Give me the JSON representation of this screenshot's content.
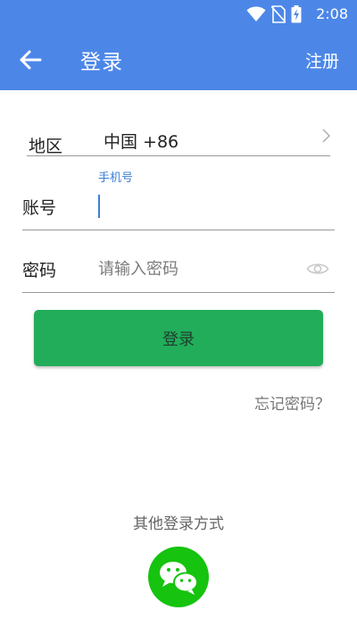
{
  "status_bar": {
    "time": "2:08",
    "icons": [
      "wifi-icon",
      "no-sim-icon",
      "battery-charging-icon"
    ]
  },
  "toolbar": {
    "back_icon": "arrow-left-icon",
    "title": "登录",
    "register_label": "注册"
  },
  "form": {
    "region": {
      "label": "地区",
      "value": "中国 +86",
      "icon": "chevron-right-icon"
    },
    "phone": {
      "label": "账号",
      "float_label": "手机号",
      "value": ""
    },
    "password": {
      "label": "密码",
      "placeholder": "请输入密码",
      "icon": "eye-icon"
    }
  },
  "login_button_label": "登录",
  "forgot_password_label": "忘记密码？",
  "other_login": {
    "label": "其他登录方式",
    "icon": "wechat-icon"
  },
  "colors": {
    "app_bar": "#4c87e8",
    "primary_button": "#22ad5b",
    "accent": "#3c7fd6",
    "wechat": "#16c30f"
  }
}
